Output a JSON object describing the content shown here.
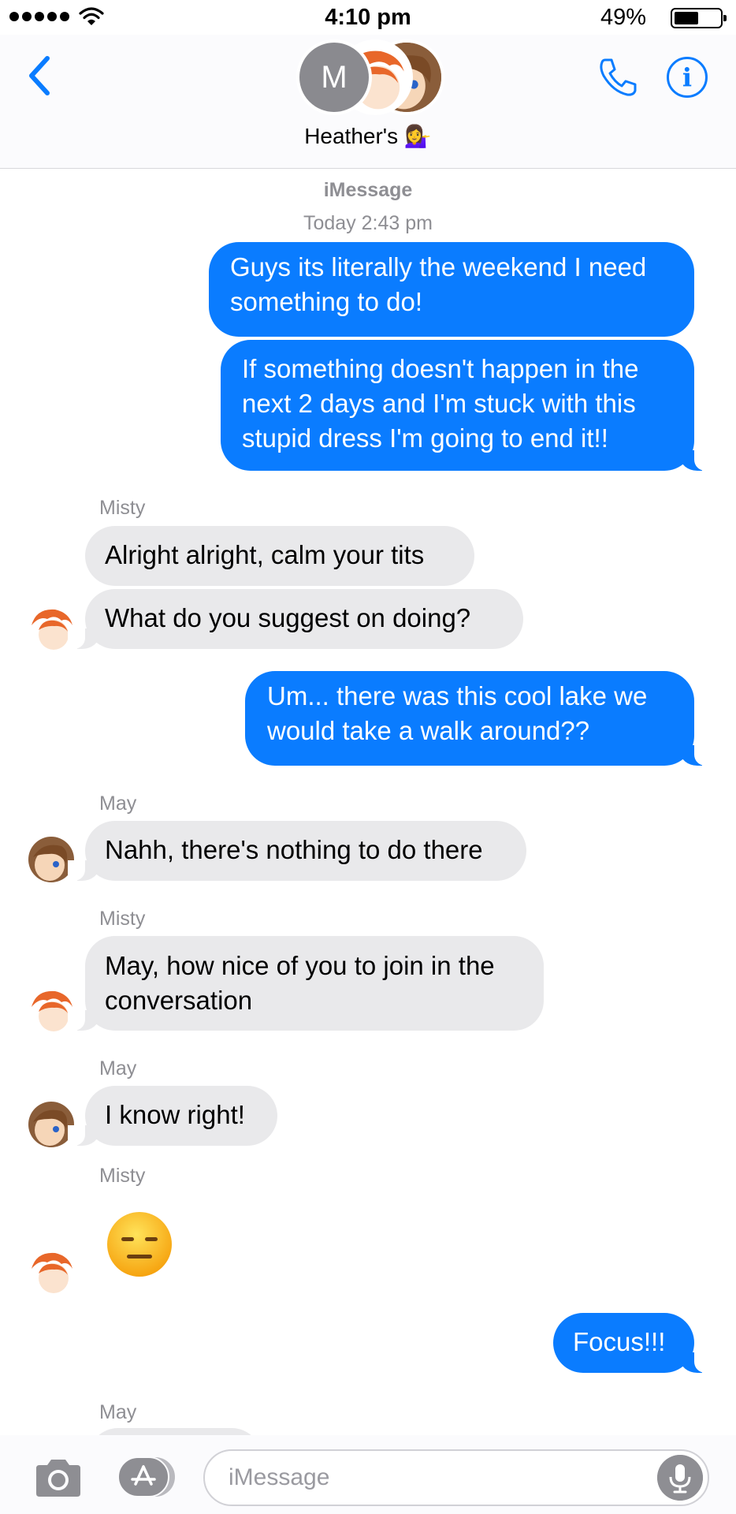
{
  "status_bar": {
    "time": "4:10 pm",
    "battery": "49%"
  },
  "header": {
    "avatar_initial": "M",
    "group_name": "Heather's 💁‍♀️"
  },
  "thread": {
    "service": "iMessage",
    "timestamp": "Today 2:43 pm",
    "messages": [
      {
        "from": "me",
        "text": "Guys its literally the weekend I need something to do!"
      },
      {
        "from": "me",
        "text": "If something doesn't happen in the next 2 days and I'm stuck with this stupid dress I'm going to end it!!"
      },
      {
        "from": "Misty",
        "sender_label": "Misty",
        "text": "Alright alright, calm your tits"
      },
      {
        "from": "Misty",
        "text": "What do you suggest on doing?"
      },
      {
        "from": "me",
        "text": "Um... there was this cool lake we would take a walk around??"
      },
      {
        "from": "May",
        "sender_label": "May",
        "text": "Nahh, there's nothing to do there"
      },
      {
        "from": "Misty",
        "sender_label": "Misty",
        "text": "May, how nice of you to join in the conversation"
      },
      {
        "from": "May",
        "sender_label": "May",
        "text": "I know right!"
      },
      {
        "from": "Misty",
        "sender_label": "Misty",
        "emoji": "expressionless-face"
      },
      {
        "from": "me",
        "text": "Focus!!!"
      },
      {
        "from": "May",
        "sender_label": "May"
      }
    ]
  },
  "input": {
    "placeholder": "iMessage"
  },
  "colors": {
    "accent": "#0a7cff",
    "incoming": "#e9e9eb",
    "meta": "#8e8e93"
  }
}
